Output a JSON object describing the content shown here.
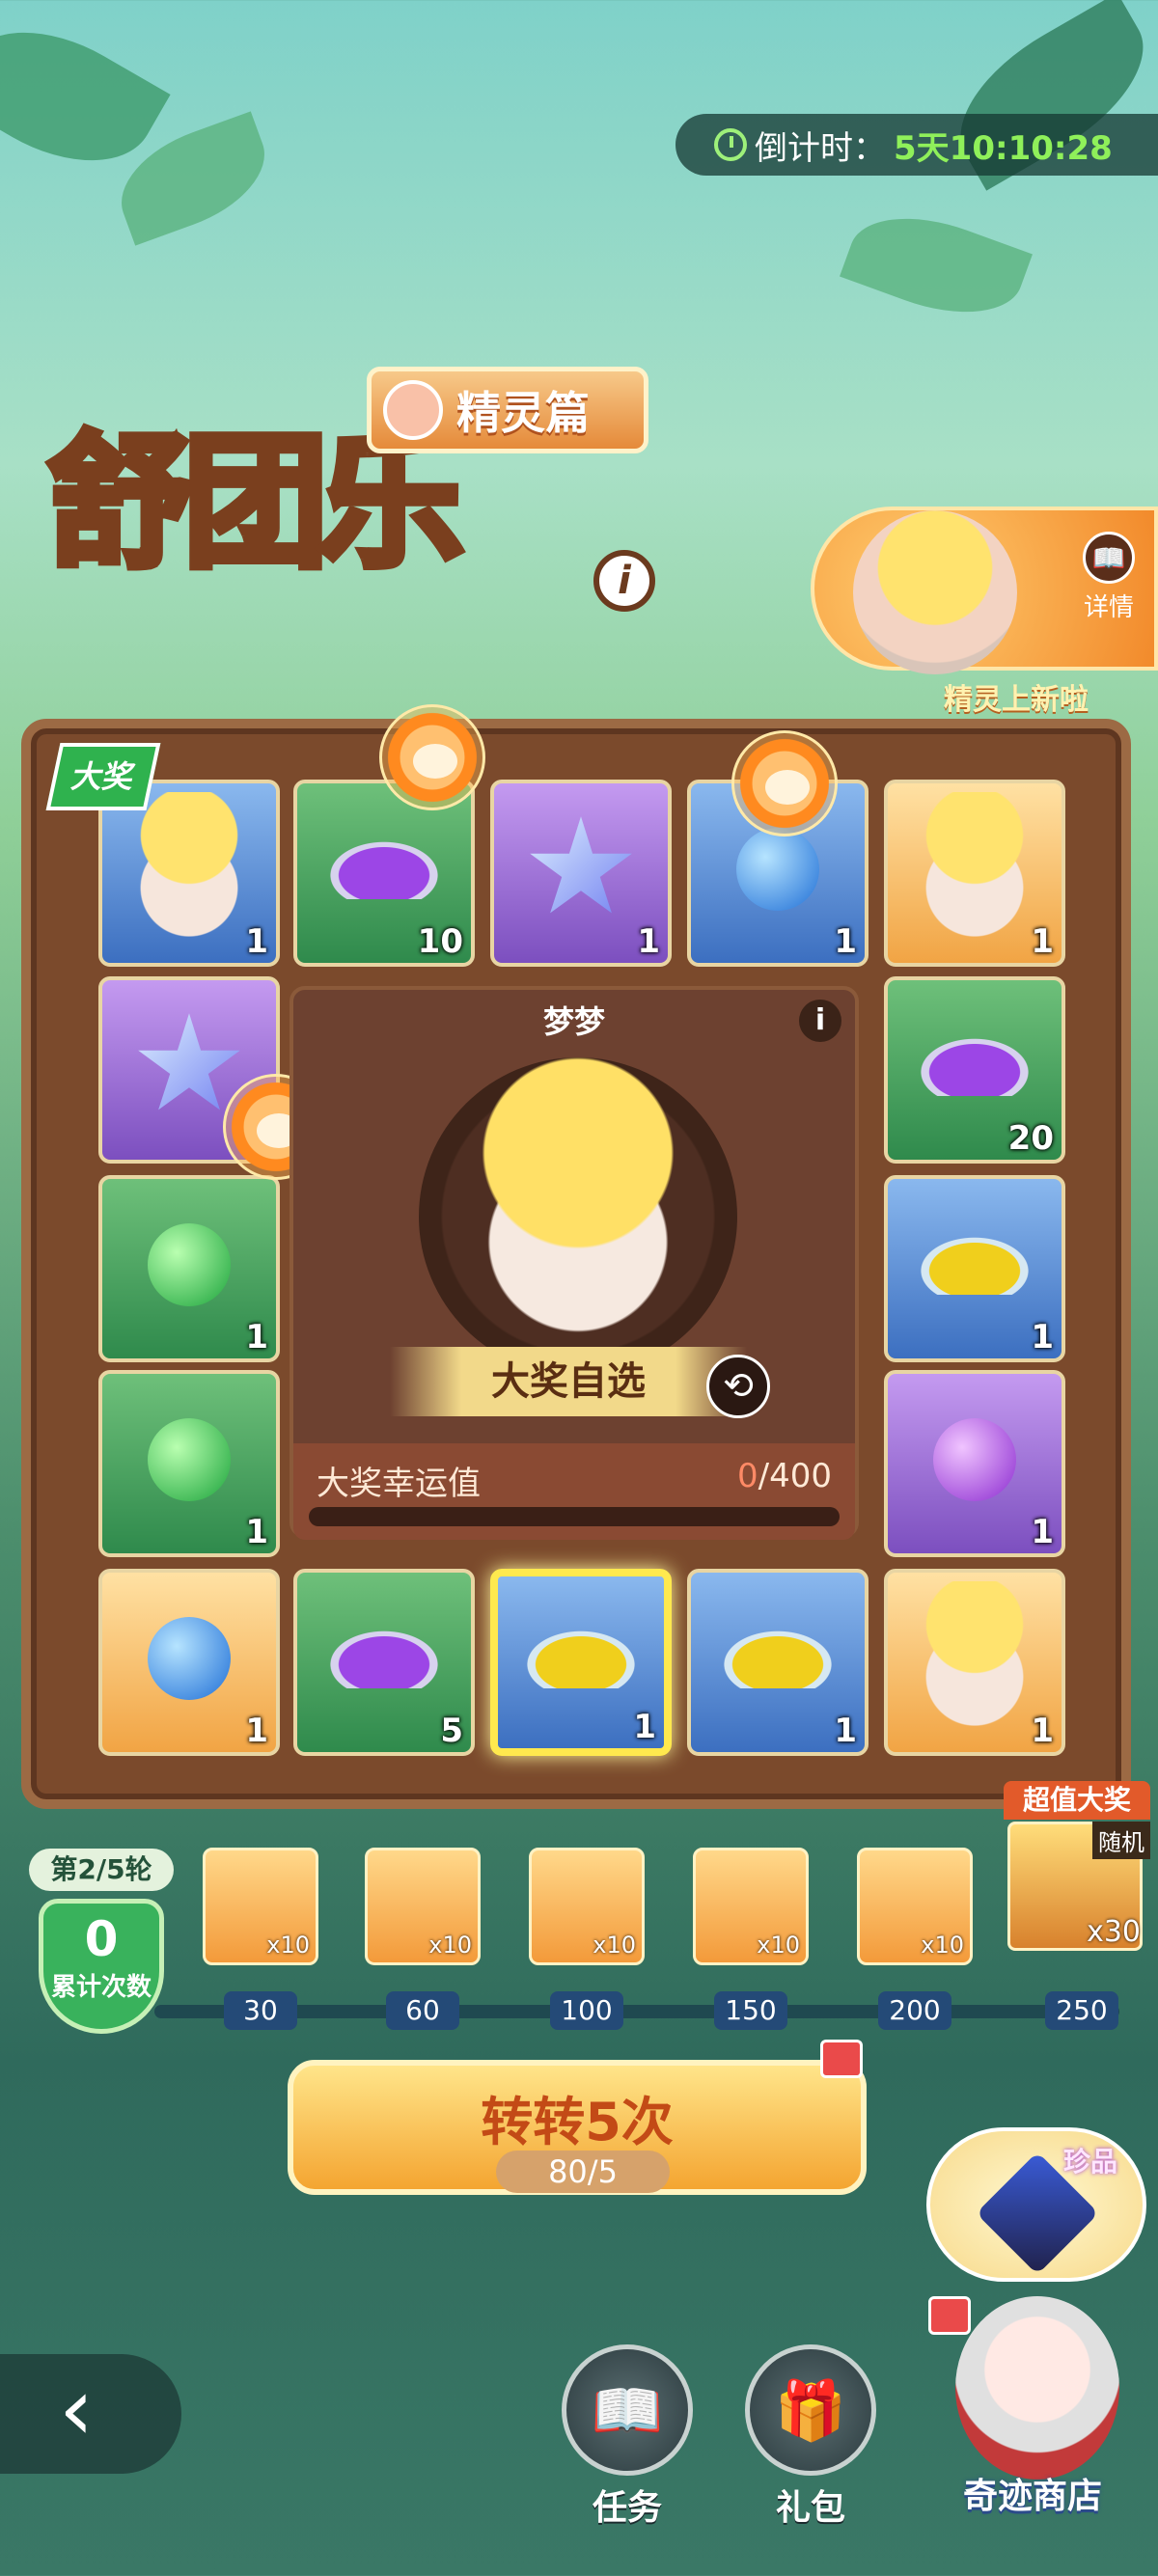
{
  "countdown": {
    "label": "倒计时：",
    "value": "5天10:10:28"
  },
  "logo": {
    "title": "舒团乐",
    "subtitle": "精灵篇",
    "info_glyph": "i"
  },
  "featured": {
    "detail_label": "详情",
    "caption": "精灵上新啦"
  },
  "badge": {
    "grand": "大奖"
  },
  "center": {
    "name": "梦梦",
    "info_glyph": "i",
    "pick_label": "大奖自选",
    "swap_glyph": "⟲",
    "luck_label": "大奖幸运值",
    "luck_current": "0",
    "luck_total": "/400",
    "luck_progress": 0
  },
  "board": {
    "cells": [
      {
        "item": "spirit-chibi",
        "color": "blue",
        "qty": "1"
      },
      {
        "item": "purple-sand",
        "color": "green",
        "qty": "10"
      },
      {
        "item": "star-crystal",
        "color": "purple",
        "qty": "1"
      },
      {
        "item": "blue-spirit-book",
        "color": "blue",
        "qty": "1"
      },
      {
        "item": "spirit-chibi",
        "color": "orange",
        "qty": "1"
      },
      {
        "item": "star-crystal",
        "color": "purple",
        "qty": "1"
      },
      {
        "item": "purple-sand",
        "color": "green",
        "qty": "20"
      },
      {
        "item": "green-spirit-book",
        "color": "green",
        "qty": "1"
      },
      {
        "item": "yellow-sand",
        "color": "blue",
        "qty": "1"
      },
      {
        "item": "green-spirit-book",
        "color": "green",
        "qty": "1"
      },
      {
        "item": "purple-spirit-book",
        "color": "purple",
        "qty": "1"
      },
      {
        "item": "spirit-emblem",
        "color": "orange",
        "qty": "1"
      },
      {
        "item": "purple-sand",
        "color": "green",
        "qty": "5"
      },
      {
        "item": "yellow-sand",
        "color": "blue",
        "qty": "1"
      },
      {
        "item": "yellow-sand",
        "color": "blue",
        "qty": "1"
      },
      {
        "item": "spirit-chibi",
        "color": "orange",
        "qty": "1"
      }
    ]
  },
  "progress": {
    "round_label": "第2/5轮",
    "count": "0",
    "count_label": "累计次数",
    "milestones": [
      {
        "threshold": "30",
        "mult": "x10"
      },
      {
        "threshold": "60",
        "mult": "x10"
      },
      {
        "threshold": "100",
        "mult": "x10"
      },
      {
        "threshold": "150",
        "mult": "x10"
      },
      {
        "threshold": "200",
        "mult": "x10"
      }
    ],
    "grand": {
      "header": "超值大奖",
      "tag": "随机",
      "mult": "x30",
      "threshold": "250"
    }
  },
  "spin": {
    "label": "转转5次",
    "cost": "80/5"
  },
  "relic": {
    "tag": "珍品"
  },
  "shop": {
    "label": "奇迹商店"
  },
  "nav": {
    "back_glyph": "‹",
    "task_label": "任务",
    "gift_label": "礼包",
    "task_icon": "📖",
    "gift_icon": "🎁"
  },
  "colors": {
    "accent": "#8ff05a",
    "board": "#7b4a2c",
    "spin": "#f4a531"
  }
}
